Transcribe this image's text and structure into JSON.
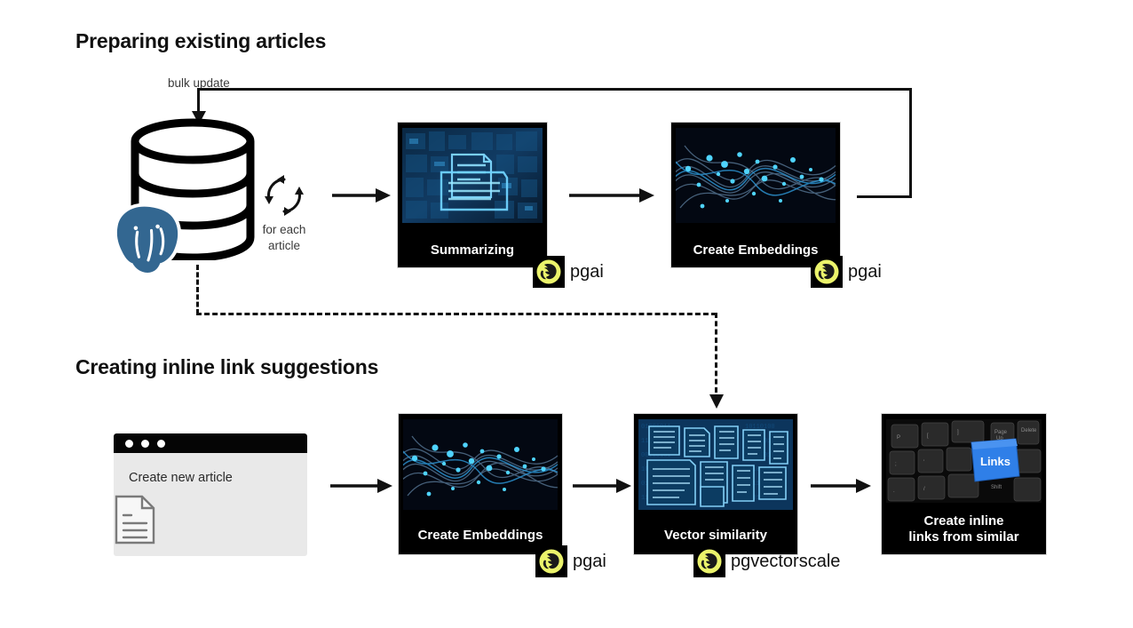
{
  "sections": {
    "top": {
      "title": "Preparing existing articles"
    },
    "bottom": {
      "title": "Creating inline link suggestions"
    }
  },
  "connectors": {
    "bulk_update_label": "bulk update",
    "loop_label": "for each\narticle",
    "loop_label_line1": "for each",
    "loop_label_line2": "article"
  },
  "top_row": {
    "database": {
      "name": "postgres-database",
      "logo": "postgresql-elephant",
      "logo_color": "#336791"
    },
    "cards": [
      {
        "caption": "Summarizing",
        "image": "blue-document-folder-graphic"
      },
      {
        "caption": "Create Embeddings",
        "image": "blue-neural-network-waves-graphic"
      }
    ],
    "badges": [
      {
        "label": "pgai",
        "icon": "pgai-elephant-icon",
        "color": "#EBF36B"
      },
      {
        "label": "pgai",
        "icon": "pgai-elephant-icon",
        "color": "#EBF36B"
      }
    ]
  },
  "bottom_row": {
    "browser": {
      "title_text": "Create new article",
      "dots": 3,
      "doc_icon": "document-icon"
    },
    "cards": [
      {
        "caption": "Create Embeddings",
        "image": "blue-neural-network-waves-graphic"
      },
      {
        "caption": "Vector similarity",
        "image": "blue-documents-grid-graphic"
      },
      {
        "caption": "Create inline\nlinks from similar",
        "caption_line1": "Create inline",
        "caption_line2": "links from similar",
        "image": "keyboard-links-key-graphic",
        "key_label": "Links"
      }
    ],
    "badges": [
      {
        "label": "pgai",
        "icon": "pgai-elephant-icon",
        "color": "#EBF36B"
      },
      {
        "label": "pgvectorscale",
        "icon": "pgai-elephant-icon",
        "color": "#EBF36B"
      }
    ]
  },
  "colors": {
    "background": "#ffffff",
    "ink": "#111111",
    "card_bg": "#000000",
    "postgres_blue": "#336791",
    "pgai_yellow": "#EBF36B",
    "browser_body": "#e9e9e9",
    "links_key_blue": "#2f7fe8"
  }
}
